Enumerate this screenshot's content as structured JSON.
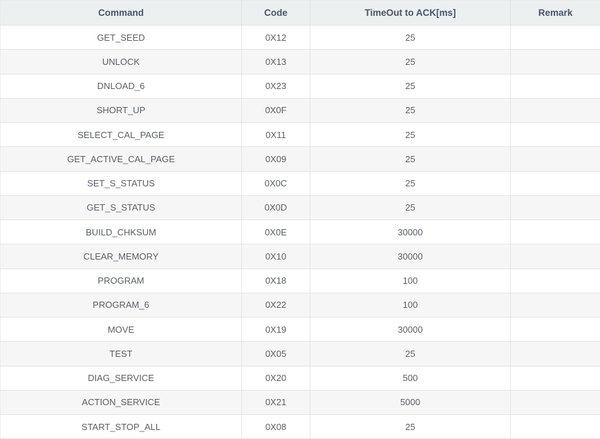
{
  "table": {
    "columns": [
      {
        "key": "command",
        "label": "Command"
      },
      {
        "key": "code",
        "label": "Code"
      },
      {
        "key": "timeout",
        "label": "TimeOut to ACK[ms]"
      },
      {
        "key": "remark",
        "label": "Remark"
      }
    ],
    "rows": [
      {
        "command": "GET_SEED",
        "code": "0X12",
        "timeout": "25",
        "remark": ""
      },
      {
        "command": "UNLOCK",
        "code": "0X13",
        "timeout": "25",
        "remark": ""
      },
      {
        "command": "DNLOAD_6",
        "code": "0X23",
        "timeout": "25",
        "remark": ""
      },
      {
        "command": "SHORT_UP",
        "code": "0X0F",
        "timeout": "25",
        "remark": ""
      },
      {
        "command": "SELECT_CAL_PAGE",
        "code": "0X11",
        "timeout": "25",
        "remark": ""
      },
      {
        "command": "GET_ACTIVE_CAL_PAGE",
        "code": "0X09",
        "timeout": "25",
        "remark": ""
      },
      {
        "command": "SET_S_STATUS",
        "code": "0X0C",
        "timeout": "25",
        "remark": ""
      },
      {
        "command": "GET_S_STATUS",
        "code": "0X0D",
        "timeout": "25",
        "remark": ""
      },
      {
        "command": "BUILD_CHKSUM",
        "code": "0X0E",
        "timeout": "30000",
        "remark": ""
      },
      {
        "command": "CLEAR_MEMORY",
        "code": "0X10",
        "timeout": "30000",
        "remark": ""
      },
      {
        "command": "PROGRAM",
        "code": "0X18",
        "timeout": "100",
        "remark": ""
      },
      {
        "command": "PROGRAM_6",
        "code": "0X22",
        "timeout": "100",
        "remark": ""
      },
      {
        "command": "MOVE",
        "code": "0X19",
        "timeout": "30000",
        "remark": ""
      },
      {
        "command": "TEST",
        "code": "0X05",
        "timeout": "25",
        "remark": ""
      },
      {
        "command": "DIAG_SERVICE",
        "code": "0X20",
        "timeout": "500",
        "remark": ""
      },
      {
        "command": "ACTION_SERVICE",
        "code": "0X21",
        "timeout": "5000",
        "remark": ""
      },
      {
        "command": "START_STOP_ALL",
        "code": "0X08",
        "timeout": "25",
        "remark": ""
      }
    ]
  },
  "colors": {
    "header_background": "#ecf0f1",
    "header_text": "#4a5568",
    "row_odd_background": "#ffffff",
    "row_even_background": "#f6f6f6",
    "body_text": "#5a5f66",
    "border": "#e4e4e4"
  }
}
